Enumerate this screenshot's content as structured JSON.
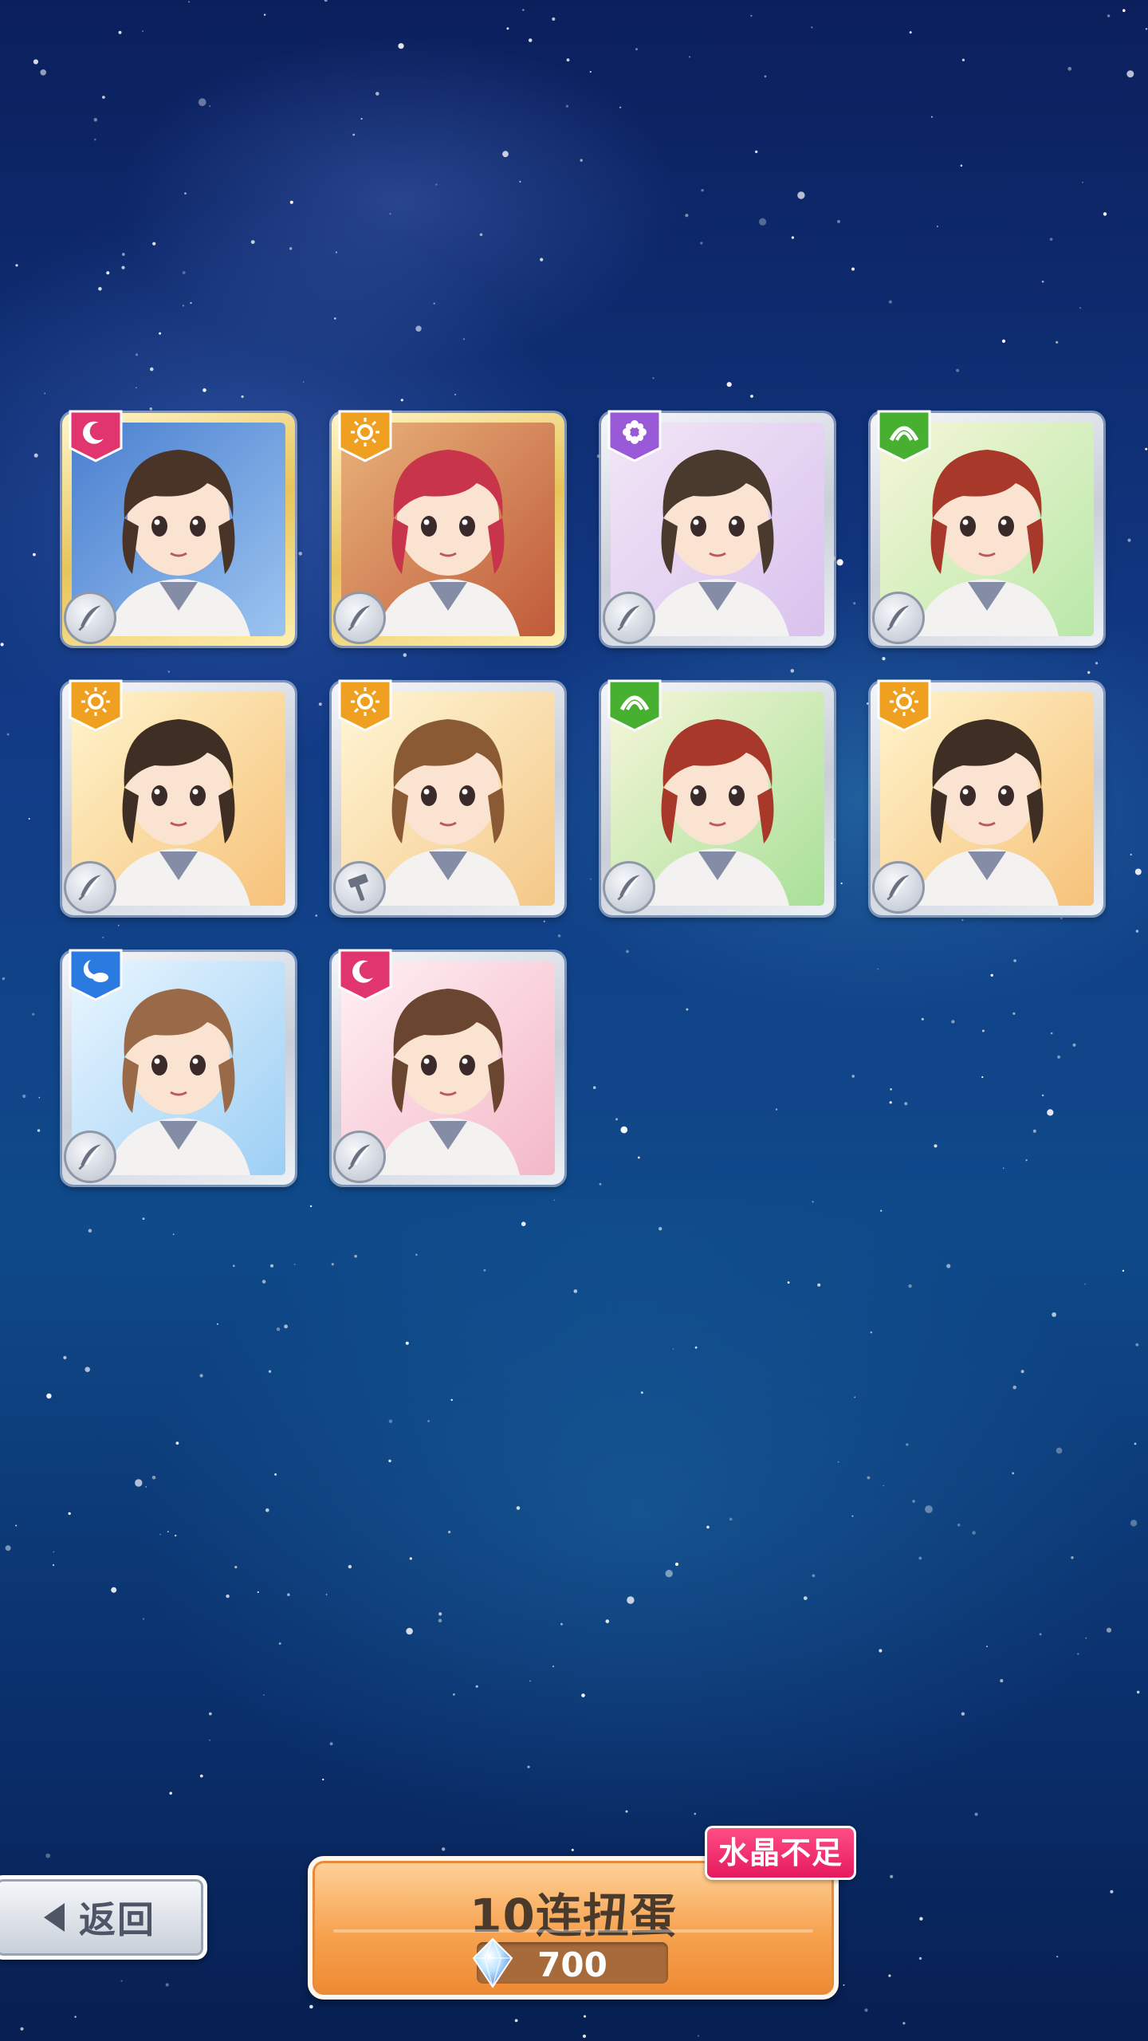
{
  "cards": [
    {
      "type_icon": "moon-icon",
      "type_color": "#e0356e",
      "role_icon": "feather-icon",
      "frame": "gold",
      "hair": "#4a3428",
      "bg": [
        "#4a7fd0",
        "#9bc4f0"
      ]
    },
    {
      "type_icon": "sun-icon",
      "type_color": "#f0a020",
      "role_icon": "feather-icon",
      "frame": "gold",
      "hair": "#c8344a",
      "bg": [
        "#e8b27a",
        "#c05a3a"
      ]
    },
    {
      "type_icon": "flower-icon",
      "type_color": "#9a5ad8",
      "role_icon": "feather-icon",
      "frame": "silver",
      "hair": "#4a3a2e",
      "bg": [
        "#f2e6f6",
        "#d9c2ee"
      ]
    },
    {
      "type_icon": "leaf-icon",
      "type_color": "#48b030",
      "role_icon": "feather-icon",
      "frame": "silver",
      "hair": "#a8382a",
      "bg": [
        "#f6f6d8",
        "#b8e8a8"
      ]
    },
    {
      "type_icon": "sun-icon",
      "type_color": "#f0a020",
      "role_icon": "feather-icon",
      "frame": "silver",
      "hair": "#3e2e24",
      "bg": [
        "#fff4cc",
        "#f6c27a"
      ]
    },
    {
      "type_icon": "sun-icon",
      "type_color": "#f0a020",
      "role_icon": "hammer-icon",
      "frame": "silver",
      "hair": "#8a5a34",
      "bg": [
        "#fff6d6",
        "#f4c888"
      ]
    },
    {
      "type_icon": "leaf-icon",
      "type_color": "#48b030",
      "role_icon": "feather-icon",
      "frame": "silver",
      "hair": "#a8382a",
      "bg": [
        "#f6f6d8",
        "#a8e098"
      ]
    },
    {
      "type_icon": "sun-icon",
      "type_color": "#f0a020",
      "role_icon": "feather-icon",
      "frame": "silver",
      "hair": "#3e2e24",
      "bg": [
        "#fff4cc",
        "#f6c27a"
      ]
    },
    {
      "type_icon": "cloud-moon-icon",
      "type_color": "#2a7ae0",
      "role_icon": "feather-icon",
      "frame": "silver",
      "hair": "#9a6a48",
      "bg": [
        "#eaf6ff",
        "#9ccff4"
      ]
    },
    {
      "type_icon": "moon-icon",
      "type_color": "#e0356e",
      "role_icon": "feather-icon",
      "frame": "silver",
      "hair": "#6a4630",
      "bg": [
        "#fff0f4",
        "#f4b8c8"
      ]
    }
  ],
  "back_button": {
    "label": "返回"
  },
  "gacha_button": {
    "title": "10连扭蛋",
    "cost": "700",
    "warning": "水晶不足"
  }
}
